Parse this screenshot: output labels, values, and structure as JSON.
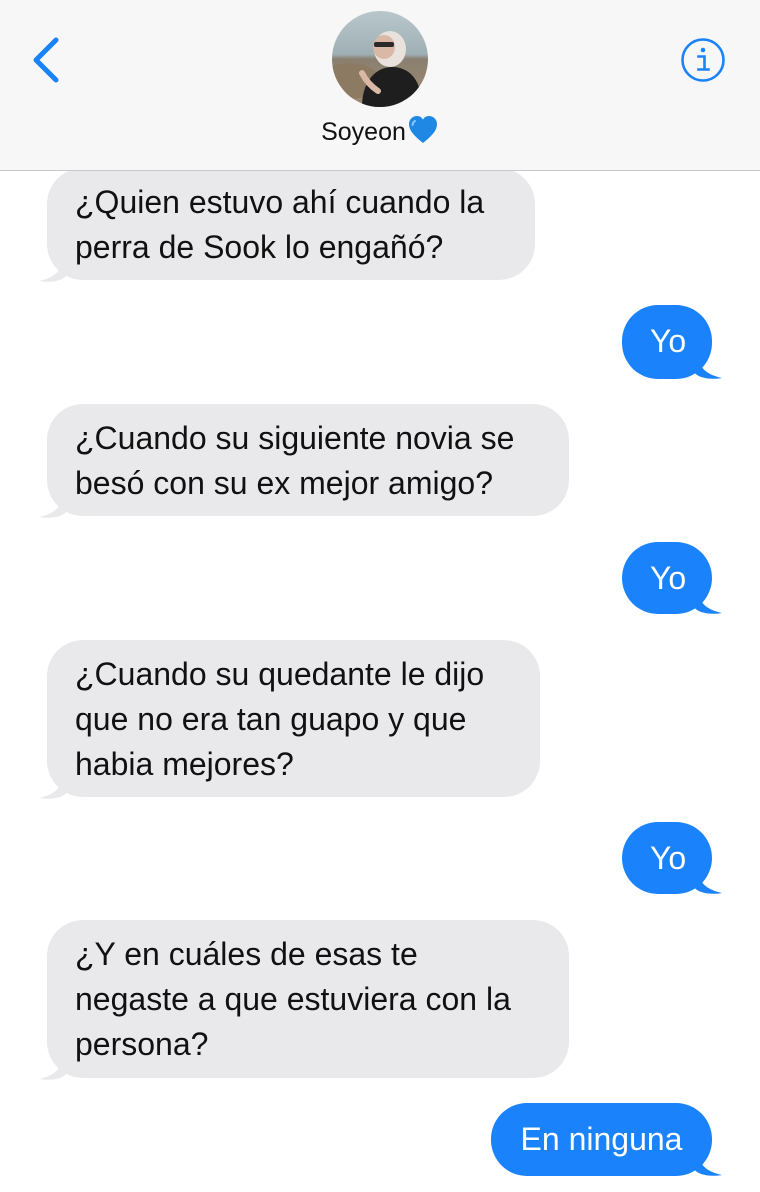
{
  "header": {
    "contact_name": "Soyeon",
    "contact_emoji": "💙",
    "back_icon": "chevron-left-icon",
    "info_icon": "info-circle-icon"
  },
  "colors": {
    "accent": "#1a82fb",
    "incoming_bubble": "#e9e9eb",
    "header_bg": "#f7f7f7"
  },
  "messages": [
    {
      "direction": "incoming",
      "text": "¿Quien estuvo ahí cuando la\nperra de Sook lo engañó?"
    },
    {
      "direction": "outgoing",
      "text": "Yo"
    },
    {
      "direction": "incoming",
      "text": "¿Cuando su siguiente novia se\nbesó con su ex mejor amigo?"
    },
    {
      "direction": "outgoing",
      "text": "Yo"
    },
    {
      "direction": "incoming",
      "text": "¿Cuando su quedante le dijo\nque no era tan guapo y que\nhabia mejores?"
    },
    {
      "direction": "outgoing",
      "text": "Yo"
    },
    {
      "direction": "incoming",
      "text": "¿Y en cuáles de esas te\nnegaste a que estuviera con la\npersona?"
    },
    {
      "direction": "outgoing",
      "text": "En ninguna"
    }
  ]
}
